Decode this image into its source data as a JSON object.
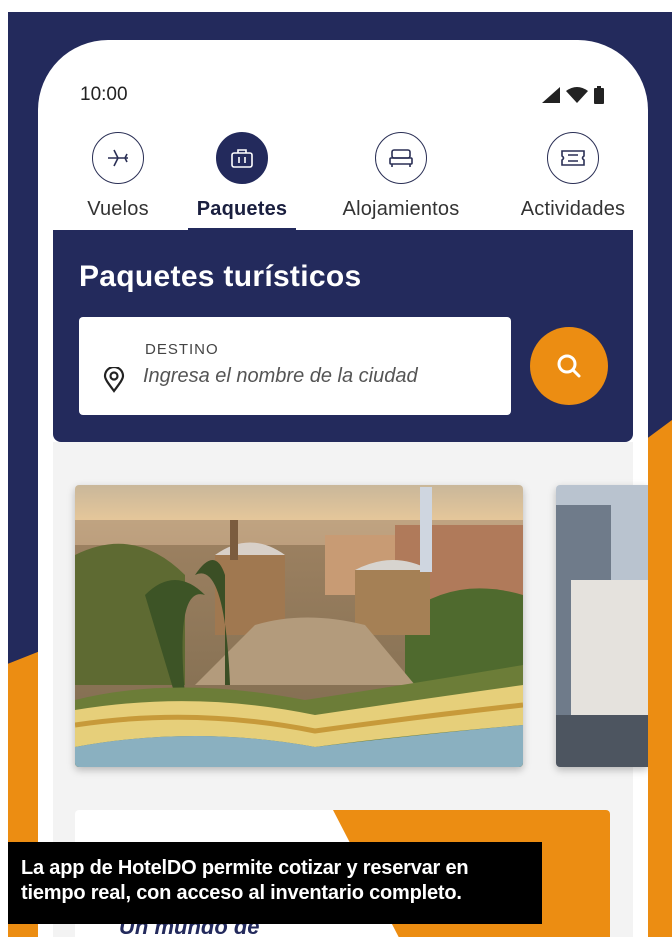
{
  "status_bar": {
    "time": "10:00"
  },
  "tabs": [
    {
      "label": "Vuelos",
      "icon": "plane-icon",
      "active": false
    },
    {
      "label": "Paquetes",
      "icon": "suitcase-icon",
      "active": true
    },
    {
      "label": "Alojamientos",
      "icon": "bed-icon",
      "active": false
    },
    {
      "label": "Actividades",
      "icon": "ticket-icon",
      "active": false
    }
  ],
  "hero": {
    "title": "Paquetes turísticos",
    "destination_label": "DESTINO",
    "destination_placeholder": "Ingresa el nombre de la ciudad"
  },
  "promo": {
    "text": "Un mundo de"
  },
  "caption": {
    "line1": "La app de HotelDO permite cotizar y reservar en",
    "line2": "tiempo real, con acceso al inventario completo."
  },
  "colors": {
    "navy": "#232a5c",
    "orange": "#ec8d12"
  }
}
